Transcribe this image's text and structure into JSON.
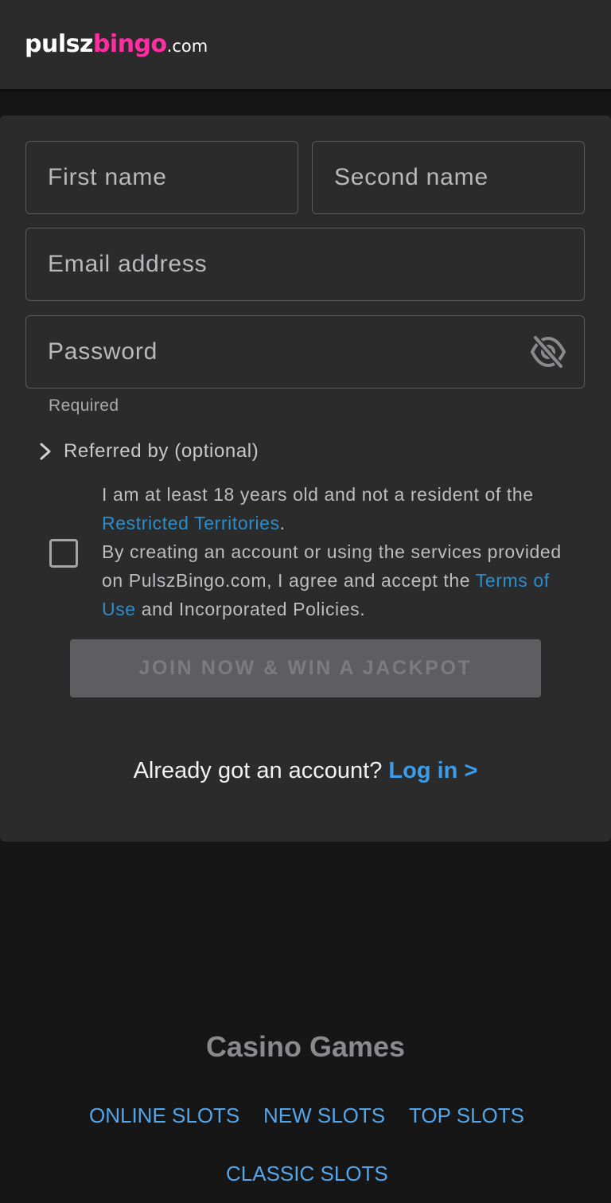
{
  "header": {
    "logo_part1": "pulsz",
    "logo_part2": "bingo",
    "logo_part3": ".com"
  },
  "form": {
    "first_name_placeholder": "First name",
    "second_name_placeholder": "Second name",
    "email_placeholder": "Email address",
    "password_placeholder": "Password",
    "password_helper": "Required",
    "referred_label": "Referred by (optional)",
    "terms_line1": "I am at least 18 years old and not a resident of the ",
    "terms_link1": "Restricted Territories",
    "terms_line1_end": ".",
    "terms_line2": "By creating an account or using the services provided on PulszBingo.com, I agree and accept the ",
    "terms_link2": "Terms of Use",
    "terms_line2_end": " and Incorporated Policies.",
    "join_button": "JOIN NOW & WIN A JACKPOT",
    "already_text": "Already got an account? ",
    "login_link": "Log in >"
  },
  "footer": {
    "title": "Casino Games",
    "links": [
      "ONLINE SLOTS",
      "NEW SLOTS",
      "TOP SLOTS",
      "CLASSIC SLOTS"
    ]
  },
  "icons": {
    "password_toggle": "eye-off-icon",
    "referred_toggle": "chevron-right-icon"
  },
  "colors": {
    "background": "#161617",
    "surface": "#2b2b2c",
    "brand_pink": "#ff2fa3",
    "link_blue": "#2a8ecc",
    "login_blue": "#3d9be8",
    "disabled_button": "#5e5e60"
  }
}
